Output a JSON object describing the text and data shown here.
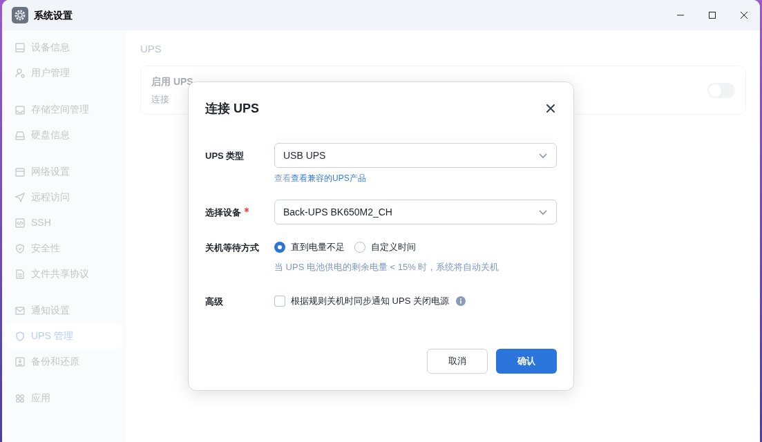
{
  "window": {
    "title": "系统设置"
  },
  "sidebar": {
    "groups": [
      {
        "items": [
          {
            "label": "设备信息",
            "selected": false
          },
          {
            "label": "用户管理",
            "selected": false
          }
        ]
      },
      {
        "items": [
          {
            "label": "存储空间管理",
            "selected": false
          },
          {
            "label": "硬盘信息",
            "selected": false
          }
        ]
      },
      {
        "items": [
          {
            "label": "网络设置",
            "selected": false
          },
          {
            "label": "远程访问",
            "selected": false
          },
          {
            "label": "SSH",
            "selected": false
          },
          {
            "label": "安全性",
            "selected": false
          },
          {
            "label": "文件共享协议",
            "selected": false
          }
        ]
      },
      {
        "items": [
          {
            "label": "通知设置",
            "selected": false
          },
          {
            "label": "UPS 管理",
            "selected": true
          },
          {
            "label": "备份和还原",
            "selected": false
          }
        ]
      },
      {
        "items": [
          {
            "label": "应用",
            "selected": false
          }
        ]
      }
    ]
  },
  "page": {
    "title": "UPS",
    "card": {
      "title": "启用 UPS",
      "subtitle": "连接",
      "on": false
    }
  },
  "dialog": {
    "title": "连接 UPS",
    "rows": [
      {
        "kind": "select",
        "label": "UPS 类型",
        "required": false,
        "value": "USB UPS",
        "help_prefix": "查看",
        "help_link": "查看兼容的UPS产品"
      },
      {
        "kind": "select",
        "label": "选择设备",
        "required": true,
        "value": "Back-UPS BK650M2_CH"
      },
      {
        "kind": "radio",
        "label": "关机等待方式",
        "options": [
          {
            "label": "直到电量不足",
            "selected": true
          },
          {
            "label": "自定义时间",
            "selected": false
          }
        ],
        "hint": "当 UPS 电池供电的剩余电量 < 15% 时，系统将自动关机"
      },
      {
        "kind": "checkbox",
        "label": "高级",
        "text": "根据规则关机时同步通知 UPS 关闭电源",
        "checked": false
      }
    ],
    "buttons": [
      {
        "label": "取消",
        "kind": "secondary"
      },
      {
        "label": "确认",
        "kind": "primary"
      }
    ]
  }
}
